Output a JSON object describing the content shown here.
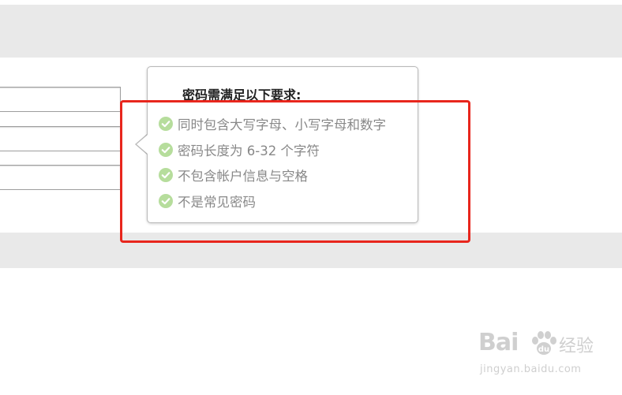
{
  "tooltip": {
    "title": "密码需满足以下要求:",
    "requirements": [
      {
        "label": "同时包含大写字母、小写字母和数字",
        "status": "satisfied",
        "icon": "check-circle-icon"
      },
      {
        "label": "密码长度为 6-32 个字符",
        "status": "satisfied",
        "icon": "check-circle-icon"
      },
      {
        "label": "不包含帐户信息与空格",
        "status": "satisfied",
        "icon": "check-circle-icon"
      },
      {
        "label": "不是常见密码",
        "status": "satisfied",
        "icon": "check-circle-icon"
      }
    ]
  },
  "form": {
    "field_1_value": "",
    "field_2_value": "",
    "field_3_value": ""
  },
  "watermark": {
    "logo": "Bai",
    "logo_suffix": "经验",
    "url": "jingyan.baidu.com"
  },
  "colors": {
    "check": "#b6dd9c",
    "highlight": "#e8261d",
    "band": "#e9e9e9",
    "requirement_text": "#888888"
  }
}
